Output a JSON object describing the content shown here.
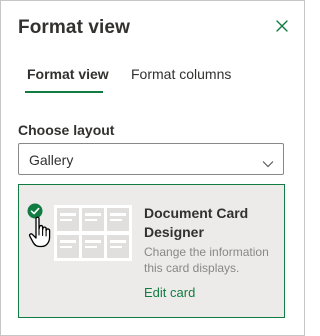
{
  "panel": {
    "title": "Format view",
    "close_icon": "close-icon"
  },
  "tabs": [
    {
      "label": "Format view",
      "selected": true
    },
    {
      "label": "Format columns",
      "selected": false
    }
  ],
  "layout": {
    "label": "Choose layout",
    "selected_value": "Gallery",
    "chevron_icon": "chevron-down-icon"
  },
  "card": {
    "title": "Document Card Designer",
    "description": "Change the information this card displays.",
    "link": "Edit card",
    "check_icon": "checkmark-circle-icon",
    "cursor_icon": "hand-pointer-icon"
  },
  "colors": {
    "accent": "#107c41",
    "card_background": "#edebe9",
    "text": "#323130",
    "muted_text": "#8a8886"
  }
}
